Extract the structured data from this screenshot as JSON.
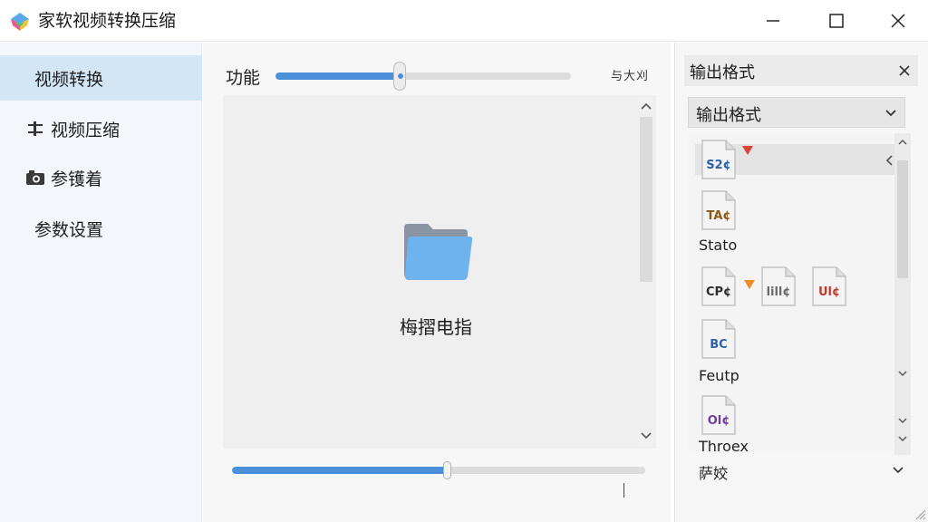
{
  "window": {
    "title": "家软视频转换压缩"
  },
  "sidebar": {
    "items": [
      {
        "label": "视频转换",
        "icon": "none",
        "active": true
      },
      {
        "label": "视频压缩",
        "icon": "sliders-icon",
        "active": false
      },
      {
        "label": "参镬着",
        "icon": "camera-icon",
        "active": false
      },
      {
        "label": "参数设置",
        "icon": "none",
        "active": false
      }
    ]
  },
  "main": {
    "function_label": "功能",
    "function_slider_value": 0.42,
    "top_right_text": "与大刈",
    "drop_zone": {
      "text": "梅摺电指",
      "icon": "folder-icon"
    },
    "bottom_slider_value": 0.52
  },
  "right_panel": {
    "title": "输出格式",
    "select_label": "输出格式",
    "formats": [
      {
        "icon_text": "S2¢",
        "name": "",
        "icon_color": "#2f5fa8",
        "flag_color": "#d9463a"
      },
      {
        "icon_text": "TA¢",
        "name": "Stato",
        "icon_color": "#8a5a1a"
      },
      {
        "icon_text": "CP¢",
        "name": "",
        "icon_color": "#2c2c2c",
        "flag_color": "#f08a2a"
      },
      {
        "icon_text": "lill¢",
        "name": "",
        "icon_color": "#6a6a6a"
      },
      {
        "icon_text": "Ul¢",
        "name": "",
        "icon_color": "#c0392b"
      },
      {
        "icon_text": "BC",
        "name": "Feutp",
        "icon_color": "#2f5fa8"
      },
      {
        "icon_text": "Ol¢",
        "name": "Throex",
        "icon_color": "#6b3fa0"
      }
    ],
    "bottom_label": "萨姣"
  },
  "colors": {
    "accent": "#4a90d9",
    "sidebar_active": "#d3e6f6"
  }
}
